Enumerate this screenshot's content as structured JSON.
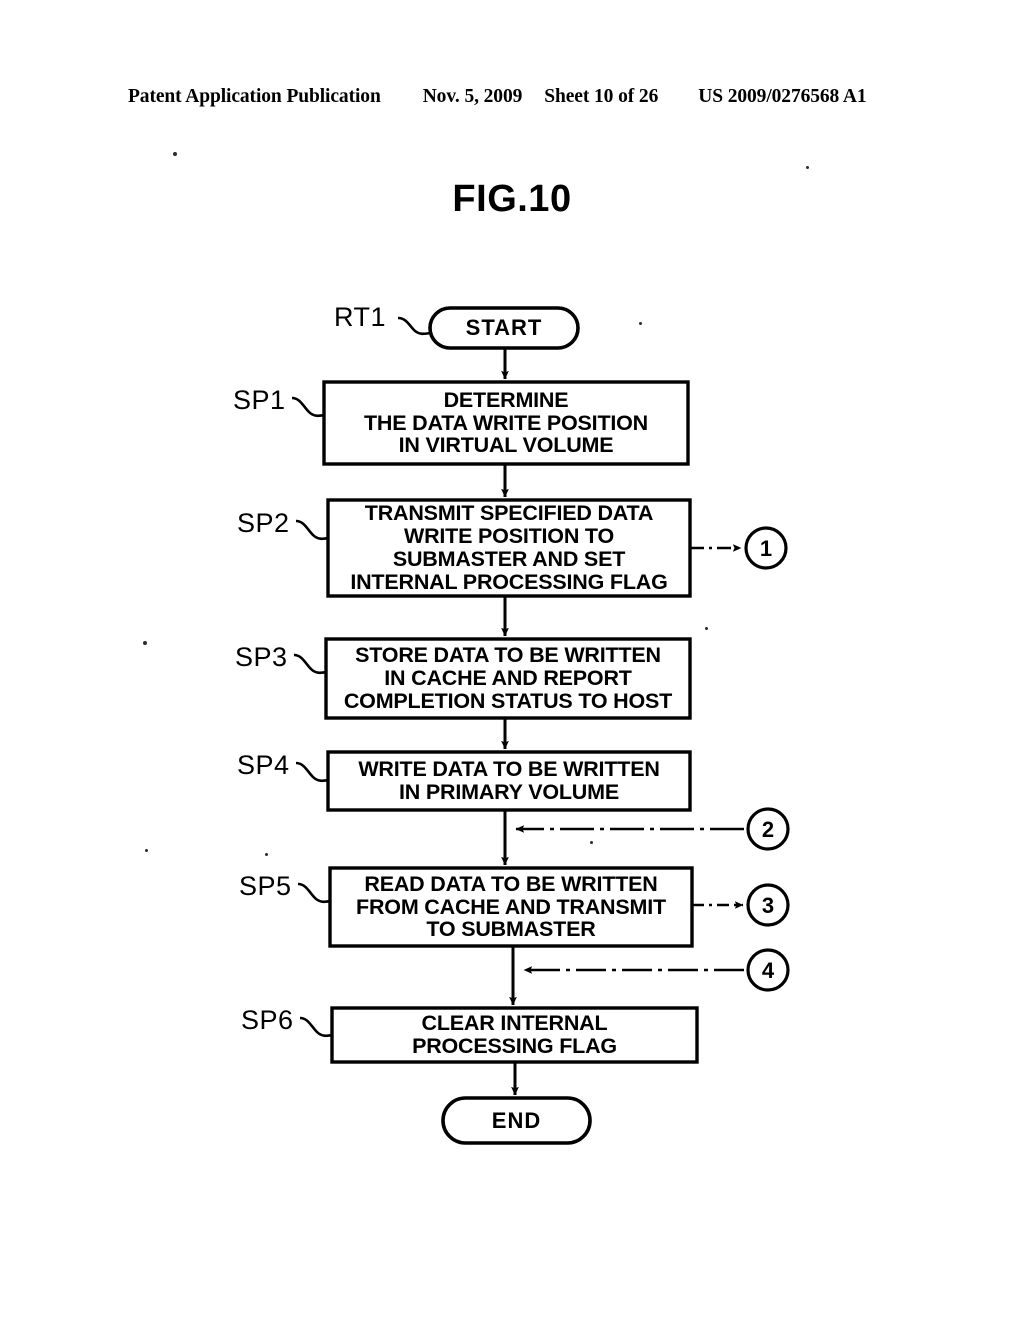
{
  "header": {
    "publication": "Patent Application Publication",
    "date": "Nov. 5, 2009",
    "sheet": "Sheet 10 of 26",
    "patent_number": "US 2009/0276568 A1"
  },
  "figure": {
    "title": "FIG.10",
    "routine_label": "RT1"
  },
  "flow": {
    "start": {
      "label": "START"
    },
    "end": {
      "label": "END"
    },
    "steps": [
      {
        "id": "SP1",
        "step_label": "SP1",
        "text": "DETERMINE\nTHE DATA WRITE POSITION\nIN VIRTUAL VOLUME"
      },
      {
        "id": "SP2",
        "step_label": "SP2",
        "text": "TRANSMIT SPECIFIED DATA\nWRITE POSITION TO\nSUBMASTER AND SET\nINTERNAL PROCESSING FLAG"
      },
      {
        "id": "SP3",
        "step_label": "SP3",
        "text": "STORE DATA TO BE WRITTEN\nIN CACHE AND REPORT\nCOMPLETION STATUS TO HOST"
      },
      {
        "id": "SP4",
        "step_label": "SP4",
        "text": "WRITE DATA TO BE WRITTEN\nIN PRIMARY VOLUME"
      },
      {
        "id": "SP5",
        "step_label": "SP5",
        "text": "READ DATA TO BE WRITTEN\nFROM CACHE AND TRANSMIT\nTO SUBMASTER"
      },
      {
        "id": "SP6",
        "step_label": "SP6",
        "text": "CLEAR INTERNAL\nPROCESSING FLAG"
      }
    ],
    "connectors": [
      {
        "id": "c1",
        "label": "1",
        "direction": "out",
        "from": "SP2"
      },
      {
        "id": "c2",
        "label": "2",
        "direction": "in",
        "to": "SP5"
      },
      {
        "id": "c3",
        "label": "3",
        "direction": "out",
        "from": "SP5"
      },
      {
        "id": "c4",
        "label": "4",
        "direction": "in",
        "to": "SP6"
      }
    ]
  },
  "colors": {
    "ink": "#000000",
    "paper": "#ffffff"
  }
}
